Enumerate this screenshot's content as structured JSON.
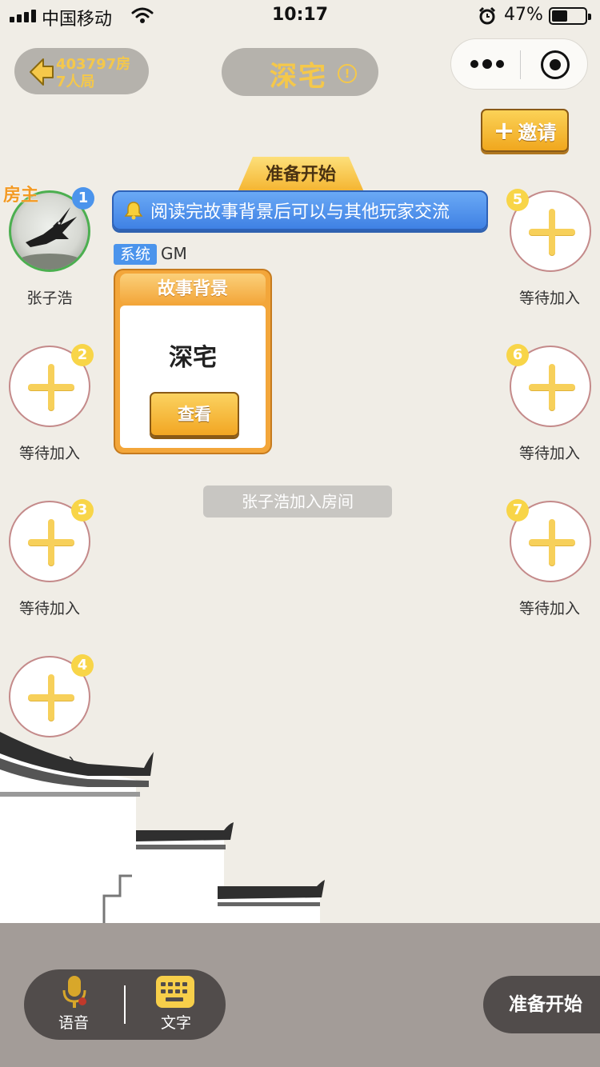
{
  "status_bar": {
    "carrier": "中国移动",
    "time": "10:17",
    "battery_percent": "47%",
    "battery_level": 0.47
  },
  "header": {
    "room_number": "403797房",
    "room_size": "7人局",
    "title": "深宅",
    "info_icon_text": "!"
  },
  "invite": {
    "plus": "+",
    "label": "邀请"
  },
  "banner": {
    "ready_label": "准备开始",
    "notice": "阅读完故事背景后可以与其他玩家交流"
  },
  "players": [
    {
      "num": "1",
      "label": "张子浩",
      "host_tag": "房主"
    },
    {
      "num": "2",
      "label": "等待加入"
    },
    {
      "num": "3",
      "label": "等待加入"
    },
    {
      "num": "4",
      "label": "等待加入"
    },
    {
      "num": "5",
      "label": "等待加入"
    },
    {
      "num": "6",
      "label": "等待加入"
    },
    {
      "num": "7",
      "label": "等待加入"
    }
  ],
  "chat": {
    "sender_badge": "系统",
    "sender_name": "GM",
    "story_card_heading": "故事背景",
    "story_title": "深宅",
    "view_button": "查看",
    "join_message": "张子浩加入房间"
  },
  "bottom": {
    "voice_label": "语音",
    "text_label": "文字",
    "ready_button": "准备开始"
  },
  "colors": {
    "accent_yellow": "#f5c84a",
    "blue": "#4b94ec",
    "bottom_bar": "#a39c98",
    "pill": "#514c4b"
  }
}
